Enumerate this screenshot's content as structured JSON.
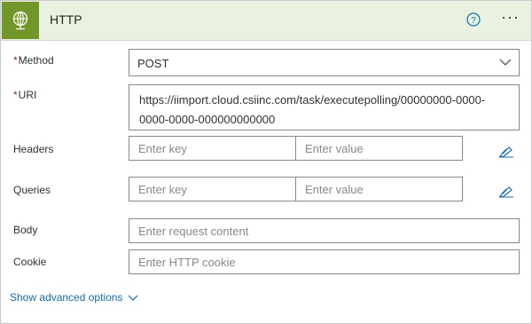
{
  "header": {
    "title": "HTTP",
    "accent": "#709727",
    "header_bg": "#e8f2df",
    "icon": "globe-icon",
    "help_icon": "help-icon",
    "more_label": "···"
  },
  "fields": {
    "method": {
      "label": "Method",
      "required": "*",
      "value": "POST"
    },
    "uri": {
      "label": "URI",
      "required": "*",
      "value": "https://iimport.cloud.csiinc.com/task/executepolling/00000000-0000-0000-0000-000000000000"
    },
    "headers": {
      "label": "Headers",
      "key_placeholder": "Enter key",
      "value_placeholder": "Enter value"
    },
    "queries": {
      "label": "Queries",
      "key_placeholder": "Enter key",
      "value_placeholder": "Enter value"
    },
    "body": {
      "label": "Body",
      "placeholder": "Enter request content"
    },
    "cookie": {
      "label": "Cookie",
      "placeholder": "Enter HTTP cookie"
    }
  },
  "advanced": {
    "label": "Show advanced options",
    "link_color": "#0f6cbd"
  }
}
